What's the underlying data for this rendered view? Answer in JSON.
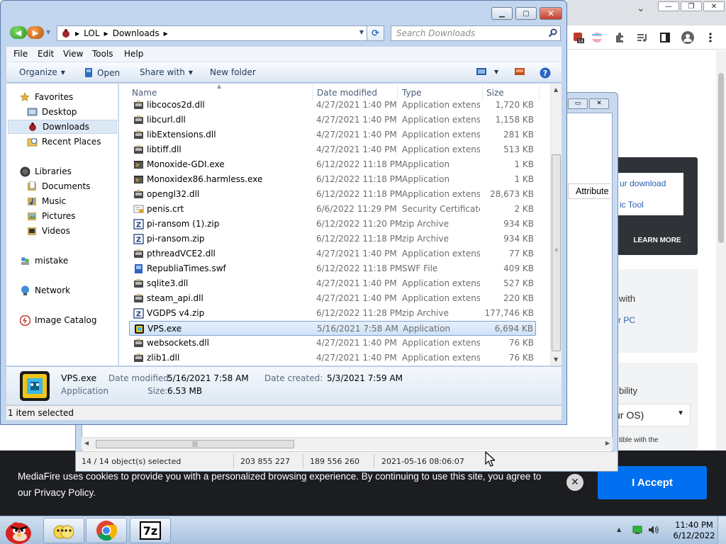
{
  "browser": {
    "window_controls": {
      "minimize": "—",
      "restore": "❐",
      "close": "✕"
    },
    "tab_dropdown": "⌄",
    "ext_badge": "14",
    "links": [
      "ur download",
      "ic Tool"
    ],
    "learn_more": "LEARN MORE",
    "card_texts": [
      "with",
      "r PC",
      "bility",
      "tible with the"
    ],
    "os_select": "ur OS)",
    "attribute_header": "Attribute",
    "colors": {
      "page_dark": "#2f3237",
      "accept_blue": "#0070f0",
      "link": "#2a5db0"
    }
  },
  "cookie_banner": {
    "text": "MediaFire uses cookies to provide you with a personalized browsing experience. By continuing to use this site, you agree to our Privacy Policy.",
    "accept": "I Accept",
    "close_icon": "✕"
  },
  "zip_window": {
    "status": {
      "selection": "14 / 14 object(s) selected",
      "size": "203 855 227",
      "packed": "189 556 260",
      "modified": "2021-05-16 08:06:07"
    }
  },
  "explorer": {
    "address": {
      "parts": [
        "LOL",
        "Downloads"
      ]
    },
    "search_placeholder": "Search Downloads",
    "menu": [
      "File",
      "Edit",
      "View",
      "Tools",
      "Help"
    ],
    "commands": {
      "organize": "Organize",
      "open": "Open",
      "share_with": "Share with",
      "new_folder": "New folder"
    },
    "nav": {
      "favorites": "Favorites",
      "desktop": "Desktop",
      "downloads": "Downloads",
      "recent": "Recent Places",
      "libraries": "Libraries",
      "documents": "Documents",
      "music": "Music",
      "pictures": "Pictures",
      "videos": "Videos",
      "mistake": "mistake",
      "network": "Network",
      "image_catalog": "Image Catalog"
    },
    "columns": {
      "name": "Name",
      "date": "Date modified",
      "type": "Type",
      "size": "Size"
    },
    "files": [
      {
        "name": "libcocos2d.dll",
        "date": "4/27/2021 1:40 PM",
        "type": "Application extens...",
        "size": "1,720 KB",
        "icon": "dll-icon"
      },
      {
        "name": "libcurl.dll",
        "date": "4/27/2021 1:40 PM",
        "type": "Application extens...",
        "size": "1,158 KB",
        "icon": "dll-icon"
      },
      {
        "name": "libExtensions.dll",
        "date": "4/27/2021 1:40 PM",
        "type": "Application extens...",
        "size": "281 KB",
        "icon": "dll-icon"
      },
      {
        "name": "libtiff.dll",
        "date": "4/27/2021 1:40 PM",
        "type": "Application extens...",
        "size": "513 KB",
        "icon": "dll-icon"
      },
      {
        "name": "Monoxide-GDI.exe",
        "date": "6/12/2022 11:18 PM",
        "type": "Application",
        "size": "1 KB",
        "icon": "exe-icon"
      },
      {
        "name": "Monoxidex86.harmless.exe",
        "date": "6/12/2022 11:18 PM",
        "type": "Application",
        "size": "1 KB",
        "icon": "exe-icon"
      },
      {
        "name": "opengl32.dll",
        "date": "6/12/2022 11:18 PM",
        "type": "Application extens...",
        "size": "28,673 KB",
        "icon": "dll-icon"
      },
      {
        "name": "penis.crt",
        "date": "6/6/2022 11:29 PM",
        "type": "Security Certificate",
        "size": "2 KB",
        "icon": "certificate-icon"
      },
      {
        "name": "pi-ransom (1).zip",
        "date": "6/12/2022 11:20 PM",
        "type": "zip Archive",
        "size": "934 KB",
        "icon": "zip-icon"
      },
      {
        "name": "pi-ransom.zip",
        "date": "6/12/2022 11:18 PM",
        "type": "zip Archive",
        "size": "934 KB",
        "icon": "zip-icon"
      },
      {
        "name": "pthreadVCE2.dll",
        "date": "4/27/2021 1:40 PM",
        "type": "Application extens...",
        "size": "77 KB",
        "icon": "dll-icon"
      },
      {
        "name": "RepubliaTimes.swf",
        "date": "6/12/2022 11:18 PM",
        "type": "SWF File",
        "size": "409 KB",
        "icon": "swf-icon"
      },
      {
        "name": "sqlite3.dll",
        "date": "4/27/2021 1:40 PM",
        "type": "Application extens...",
        "size": "527 KB",
        "icon": "dll-icon"
      },
      {
        "name": "steam_api.dll",
        "date": "4/27/2021 1:40 PM",
        "type": "Application extens...",
        "size": "220 KB",
        "icon": "dll-icon"
      },
      {
        "name": "VGDPS v4.zip",
        "date": "6/12/2022 11:28 PM",
        "type": "zip Archive",
        "size": "177,746 KB",
        "icon": "zip-icon"
      },
      {
        "name": "VPS.exe",
        "date": "5/16/2021 7:58 AM",
        "type": "Application",
        "size": "6,694 KB",
        "icon": "vps-app-icon",
        "selected": true
      },
      {
        "name": "websockets.dll",
        "date": "4/27/2021 1:40 PM",
        "type": "Application extens...",
        "size": "76 KB",
        "icon": "dll-icon"
      },
      {
        "name": "zlib1.dll",
        "date": "4/27/2021 1:40 PM",
        "type": "Application extens...",
        "size": "76 KB",
        "icon": "dll-icon"
      }
    ],
    "details": {
      "name": "VPS.exe",
      "type": "Application",
      "modified_label": "Date modified:",
      "modified_value": "5/16/2021 7:58 AM",
      "created_label": "Date created:",
      "created_value": "5/3/2021 7:59 AM",
      "size_label": "Size:",
      "size_value": "6.53 MB"
    },
    "status": "1 item selected"
  },
  "taskbar": {
    "time": "11:40 PM",
    "date": "6/12/2022",
    "apps": [
      "angry-birds-start-icon",
      "folder-icon",
      "chrome-icon",
      "7zip-icon"
    ]
  }
}
